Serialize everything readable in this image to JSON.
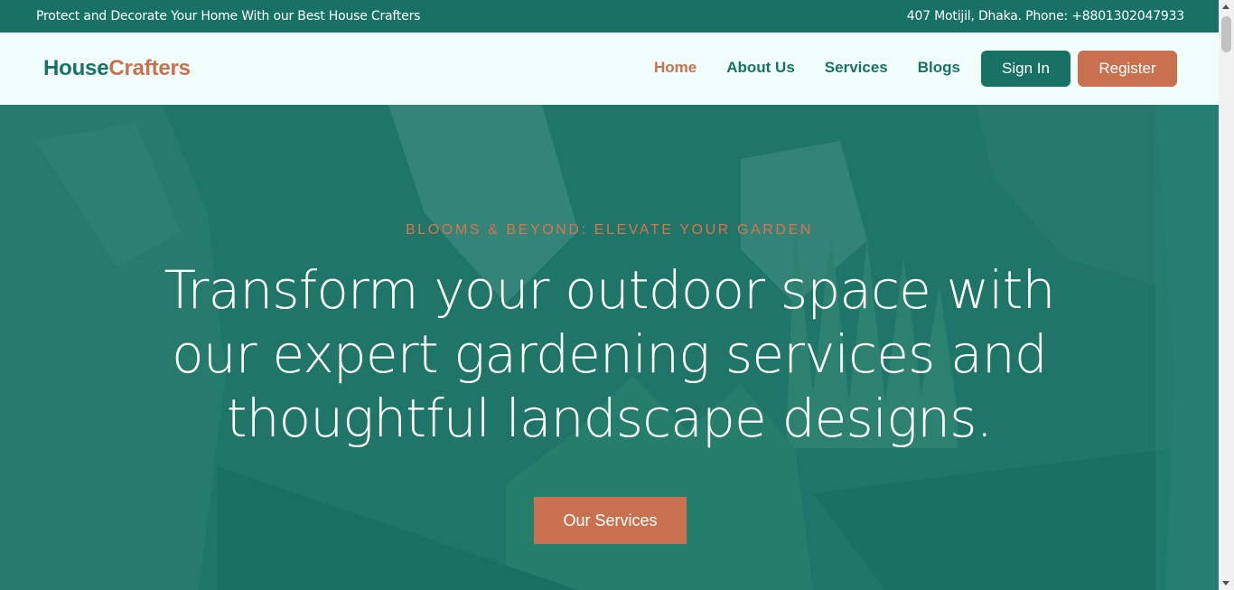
{
  "topbar": {
    "tagline": "Protect and Decorate Your Home With our Best House Crafters",
    "contact": "407 Motijil, Dhaka. Phone: +8801302047933"
  },
  "brand": {
    "part1": "House",
    "part2": "Crafters"
  },
  "nav": {
    "items": [
      {
        "label": "Home",
        "active": true
      },
      {
        "label": "About Us",
        "active": false
      },
      {
        "label": "Services",
        "active": false
      },
      {
        "label": "Blogs",
        "active": false
      }
    ],
    "signin_label": "Sign In",
    "register_label": "Register"
  },
  "hero": {
    "kicker": "BLOOMS & BEYOND: ELEVATE YOUR GARDEN",
    "title": "Transform your outdoor space with our expert gardening services and thoughtful landscape designs.",
    "cta_label": "Our Services"
  },
  "colors": {
    "primary": "#177265",
    "accent": "#c8714f",
    "nav_bg": "#f1fdfb"
  }
}
